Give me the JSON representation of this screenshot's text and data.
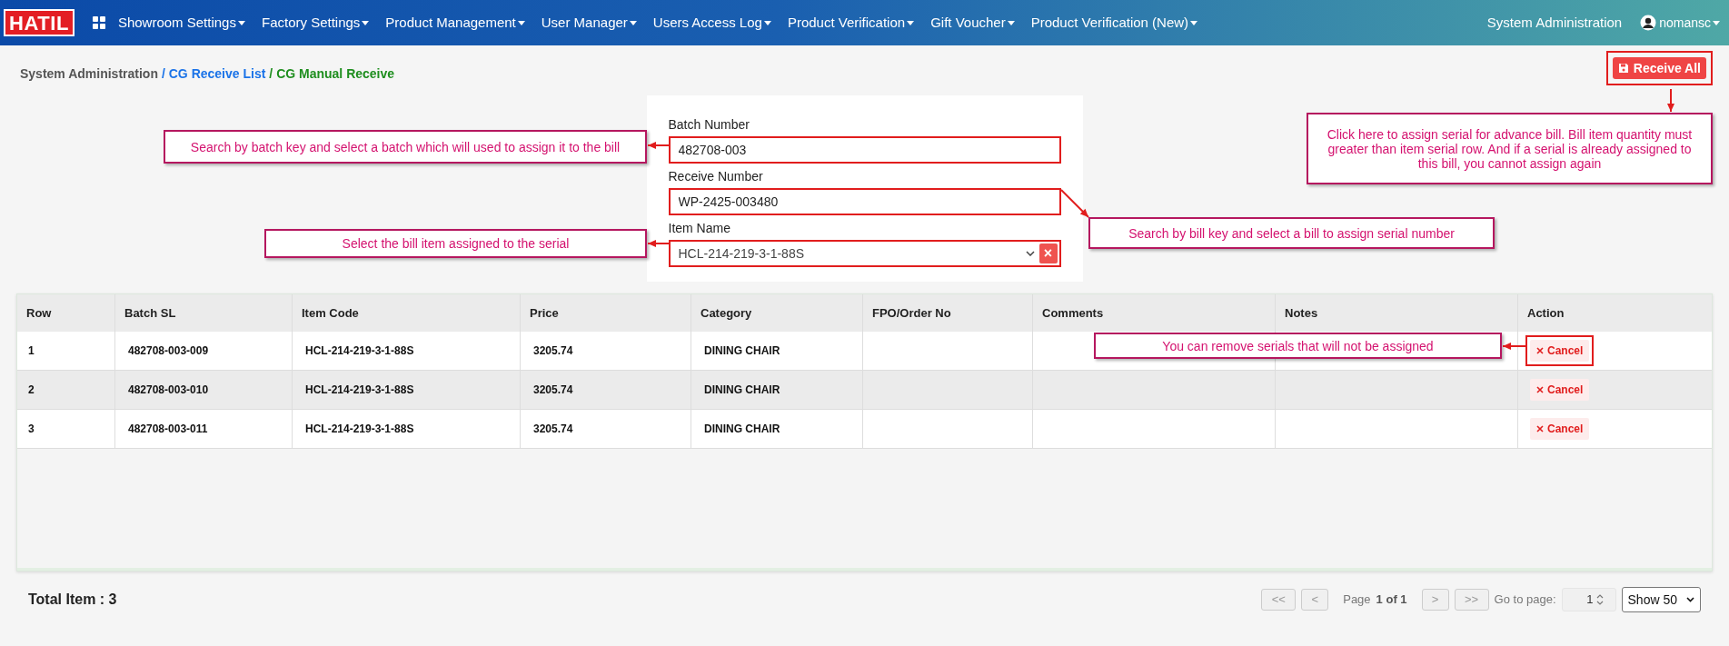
{
  "navbar": {
    "logo": "HATIL",
    "menu": [
      {
        "label": "Showroom Settings"
      },
      {
        "label": "Factory Settings"
      },
      {
        "label": "Product Management"
      },
      {
        "label": "User Manager"
      },
      {
        "label": "Users Access Log"
      },
      {
        "label": "Product Verification"
      },
      {
        "label": "Gift Voucher"
      },
      {
        "label": "Product Verification (New)"
      }
    ],
    "right_link": "System Administration",
    "user": "nomansc"
  },
  "breadcrumb": [
    {
      "label": "System Administration",
      "kind": "root"
    },
    {
      "label": "/ CG Receive List",
      "kind": "link"
    },
    {
      "label": "/ CG Manual Receive",
      "kind": "current"
    }
  ],
  "receive_all_button": "Receive All",
  "form": {
    "fields": [
      {
        "label": "Batch Number",
        "value": "482708-003",
        "kind": "text"
      },
      {
        "label": "Receive Number",
        "value": "WP-2425-003480",
        "kind": "text"
      },
      {
        "label": "Item Name",
        "value": "HCL-214-219-3-1-88S",
        "kind": "select"
      }
    ],
    "clear_icon": "×"
  },
  "table": {
    "columns": [
      "Row",
      "Batch SL",
      "Item Code",
      "Price",
      "Category",
      "FPO/Order No",
      "Comments",
      "Notes",
      "Action"
    ],
    "rows": [
      {
        "cells": [
          "1",
          "482708-003-009",
          "HCL-214-219-3-1-88S",
          "3205.74",
          "DINING CHAIR",
          "",
          "",
          ""
        ],
        "action": "Cancel",
        "highlighted": true
      },
      {
        "cells": [
          "2",
          "482708-003-010",
          "HCL-214-219-3-1-88S",
          "3205.74",
          "DINING CHAIR",
          "",
          "",
          ""
        ],
        "action": "Cancel",
        "highlighted": false
      },
      {
        "cells": [
          "3",
          "482708-003-011",
          "HCL-214-219-3-1-88S",
          "3205.74",
          "DINING CHAIR",
          "",
          "",
          ""
        ],
        "action": "Cancel",
        "highlighted": false
      }
    ]
  },
  "footer": {
    "total": "Total Item : 3",
    "first": "<<",
    "prev": "<",
    "page_label": "Page",
    "page_value": "1 of 1",
    "next": ">",
    "last": ">>",
    "goto_label": "Go to page:",
    "goto_value": "1",
    "page_size": "Show 50"
  },
  "callouts": [
    {
      "text": "Search by batch key and select a batch which will used to assign it to the bill"
    },
    {
      "text": "Select the bill item assigned to the serial"
    },
    {
      "text": "Search by bill key and select a bill to assign serial number"
    },
    {
      "text": "Click here to assign serial for advance bill. Bill item quantity must greater than item serial row. And if a serial is already assigned to this bill, you cannot assign again"
    },
    {
      "text": "You can remove serials that will not be assigned"
    }
  ]
}
